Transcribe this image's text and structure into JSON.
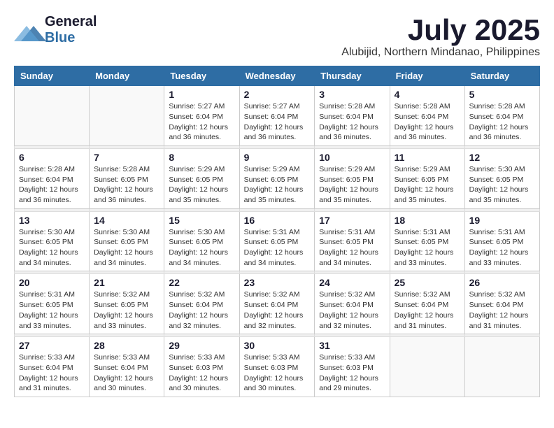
{
  "header": {
    "logo_general": "General",
    "logo_blue": "Blue",
    "month_title": "July 2025",
    "location": "Alubijid, Northern Mindanao, Philippines"
  },
  "weekdays": [
    "Sunday",
    "Monday",
    "Tuesday",
    "Wednesday",
    "Thursday",
    "Friday",
    "Saturday"
  ],
  "weeks": [
    [
      {
        "day": "",
        "sunrise": "",
        "sunset": "",
        "daylight": ""
      },
      {
        "day": "",
        "sunrise": "",
        "sunset": "",
        "daylight": ""
      },
      {
        "day": "1",
        "sunrise": "Sunrise: 5:27 AM",
        "sunset": "Sunset: 6:04 PM",
        "daylight": "Daylight: 12 hours and 36 minutes."
      },
      {
        "day": "2",
        "sunrise": "Sunrise: 5:27 AM",
        "sunset": "Sunset: 6:04 PM",
        "daylight": "Daylight: 12 hours and 36 minutes."
      },
      {
        "day": "3",
        "sunrise": "Sunrise: 5:28 AM",
        "sunset": "Sunset: 6:04 PM",
        "daylight": "Daylight: 12 hours and 36 minutes."
      },
      {
        "day": "4",
        "sunrise": "Sunrise: 5:28 AM",
        "sunset": "Sunset: 6:04 PM",
        "daylight": "Daylight: 12 hours and 36 minutes."
      },
      {
        "day": "5",
        "sunrise": "Sunrise: 5:28 AM",
        "sunset": "Sunset: 6:04 PM",
        "daylight": "Daylight: 12 hours and 36 minutes."
      }
    ],
    [
      {
        "day": "6",
        "sunrise": "Sunrise: 5:28 AM",
        "sunset": "Sunset: 6:04 PM",
        "daylight": "Daylight: 12 hours and 36 minutes."
      },
      {
        "day": "7",
        "sunrise": "Sunrise: 5:28 AM",
        "sunset": "Sunset: 6:05 PM",
        "daylight": "Daylight: 12 hours and 36 minutes."
      },
      {
        "day": "8",
        "sunrise": "Sunrise: 5:29 AM",
        "sunset": "Sunset: 6:05 PM",
        "daylight": "Daylight: 12 hours and 35 minutes."
      },
      {
        "day": "9",
        "sunrise": "Sunrise: 5:29 AM",
        "sunset": "Sunset: 6:05 PM",
        "daylight": "Daylight: 12 hours and 35 minutes."
      },
      {
        "day": "10",
        "sunrise": "Sunrise: 5:29 AM",
        "sunset": "Sunset: 6:05 PM",
        "daylight": "Daylight: 12 hours and 35 minutes."
      },
      {
        "day": "11",
        "sunrise": "Sunrise: 5:29 AM",
        "sunset": "Sunset: 6:05 PM",
        "daylight": "Daylight: 12 hours and 35 minutes."
      },
      {
        "day": "12",
        "sunrise": "Sunrise: 5:30 AM",
        "sunset": "Sunset: 6:05 PM",
        "daylight": "Daylight: 12 hours and 35 minutes."
      }
    ],
    [
      {
        "day": "13",
        "sunrise": "Sunrise: 5:30 AM",
        "sunset": "Sunset: 6:05 PM",
        "daylight": "Daylight: 12 hours and 34 minutes."
      },
      {
        "day": "14",
        "sunrise": "Sunrise: 5:30 AM",
        "sunset": "Sunset: 6:05 PM",
        "daylight": "Daylight: 12 hours and 34 minutes."
      },
      {
        "day": "15",
        "sunrise": "Sunrise: 5:30 AM",
        "sunset": "Sunset: 6:05 PM",
        "daylight": "Daylight: 12 hours and 34 minutes."
      },
      {
        "day": "16",
        "sunrise": "Sunrise: 5:31 AM",
        "sunset": "Sunset: 6:05 PM",
        "daylight": "Daylight: 12 hours and 34 minutes."
      },
      {
        "day": "17",
        "sunrise": "Sunrise: 5:31 AM",
        "sunset": "Sunset: 6:05 PM",
        "daylight": "Daylight: 12 hours and 34 minutes."
      },
      {
        "day": "18",
        "sunrise": "Sunrise: 5:31 AM",
        "sunset": "Sunset: 6:05 PM",
        "daylight": "Daylight: 12 hours and 33 minutes."
      },
      {
        "day": "19",
        "sunrise": "Sunrise: 5:31 AM",
        "sunset": "Sunset: 6:05 PM",
        "daylight": "Daylight: 12 hours and 33 minutes."
      }
    ],
    [
      {
        "day": "20",
        "sunrise": "Sunrise: 5:31 AM",
        "sunset": "Sunset: 6:05 PM",
        "daylight": "Daylight: 12 hours and 33 minutes."
      },
      {
        "day": "21",
        "sunrise": "Sunrise: 5:32 AM",
        "sunset": "Sunset: 6:05 PM",
        "daylight": "Daylight: 12 hours and 33 minutes."
      },
      {
        "day": "22",
        "sunrise": "Sunrise: 5:32 AM",
        "sunset": "Sunset: 6:04 PM",
        "daylight": "Daylight: 12 hours and 32 minutes."
      },
      {
        "day": "23",
        "sunrise": "Sunrise: 5:32 AM",
        "sunset": "Sunset: 6:04 PM",
        "daylight": "Daylight: 12 hours and 32 minutes."
      },
      {
        "day": "24",
        "sunrise": "Sunrise: 5:32 AM",
        "sunset": "Sunset: 6:04 PM",
        "daylight": "Daylight: 12 hours and 32 minutes."
      },
      {
        "day": "25",
        "sunrise": "Sunrise: 5:32 AM",
        "sunset": "Sunset: 6:04 PM",
        "daylight": "Daylight: 12 hours and 31 minutes."
      },
      {
        "day": "26",
        "sunrise": "Sunrise: 5:32 AM",
        "sunset": "Sunset: 6:04 PM",
        "daylight": "Daylight: 12 hours and 31 minutes."
      }
    ],
    [
      {
        "day": "27",
        "sunrise": "Sunrise: 5:33 AM",
        "sunset": "Sunset: 6:04 PM",
        "daylight": "Daylight: 12 hours and 31 minutes."
      },
      {
        "day": "28",
        "sunrise": "Sunrise: 5:33 AM",
        "sunset": "Sunset: 6:04 PM",
        "daylight": "Daylight: 12 hours and 30 minutes."
      },
      {
        "day": "29",
        "sunrise": "Sunrise: 5:33 AM",
        "sunset": "Sunset: 6:03 PM",
        "daylight": "Daylight: 12 hours and 30 minutes."
      },
      {
        "day": "30",
        "sunrise": "Sunrise: 5:33 AM",
        "sunset": "Sunset: 6:03 PM",
        "daylight": "Daylight: 12 hours and 30 minutes."
      },
      {
        "day": "31",
        "sunrise": "Sunrise: 5:33 AM",
        "sunset": "Sunset: 6:03 PM",
        "daylight": "Daylight: 12 hours and 29 minutes."
      },
      {
        "day": "",
        "sunrise": "",
        "sunset": "",
        "daylight": ""
      },
      {
        "day": "",
        "sunrise": "",
        "sunset": "",
        "daylight": ""
      }
    ]
  ]
}
